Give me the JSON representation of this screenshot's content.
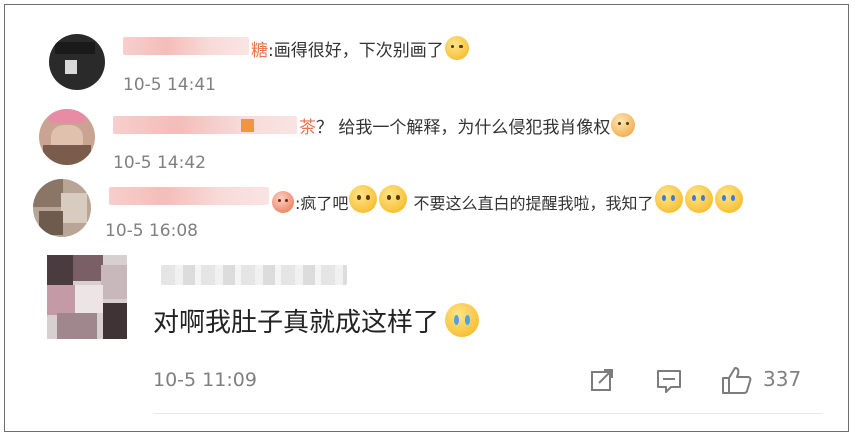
{
  "comments": [
    {
      "username_visible": "糖",
      "text": ":画得很好，下次别画了",
      "time": "10-5 14:41",
      "emoji_trailing": "doge-icon"
    },
    {
      "username_visible": "茶",
      "text": "？ 给我一个解释，为什么侵犯我肖像权",
      "time": "10-5 14:42",
      "emoji_trailing": "shiba-icon"
    },
    {
      "text_a": ":疯了吧",
      "text_b": " 不要这么直白的提醒我啦，我知了",
      "time": "10-5 16:08"
    },
    {
      "text": "对啊我肚子真就成这样了",
      "time": "10-5 11:09",
      "like_count": "337"
    }
  ],
  "colors": {
    "username": "#eb7350",
    "body_text": "#333333",
    "meta_text": "#808080",
    "divider": "#e8e8e8"
  }
}
